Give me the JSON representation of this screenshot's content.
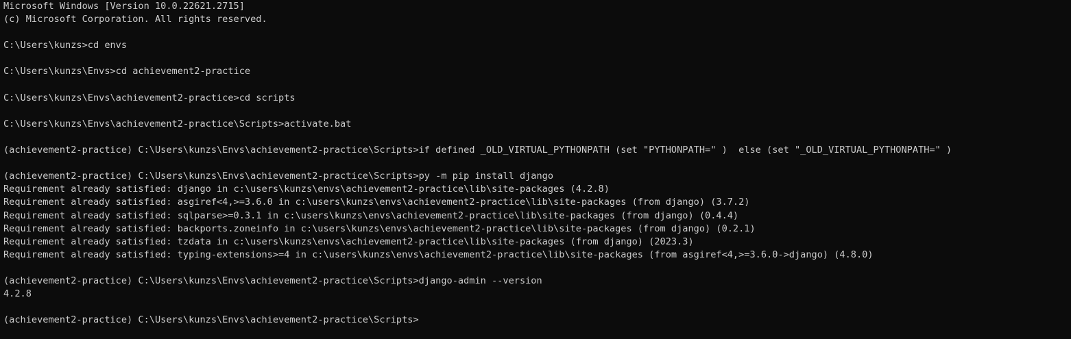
{
  "terminal": {
    "lines": [
      "Microsoft Windows [Version 10.0.22621.2715]",
      "(c) Microsoft Corporation. All rights reserved.",
      "",
      "C:\\Users\\kunzs>cd envs",
      "",
      "C:\\Users\\kunzs\\Envs>cd achievement2-practice",
      "",
      "C:\\Users\\kunzs\\Envs\\achievement2-practice>cd scripts",
      "",
      "C:\\Users\\kunzs\\Envs\\achievement2-practice\\Scripts>activate.bat",
      "",
      "(achievement2-practice) C:\\Users\\kunzs\\Envs\\achievement2-practice\\Scripts>if defined _OLD_VIRTUAL_PYTHONPATH (set \"PYTHONPATH=\" )  else (set \"_OLD_VIRTUAL_PYTHONPATH=\" )",
      "",
      "(achievement2-practice) C:\\Users\\kunzs\\Envs\\achievement2-practice\\Scripts>py -m pip install django",
      "Requirement already satisfied: django in c:\\users\\kunzs\\envs\\achievement2-practice\\lib\\site-packages (4.2.8)",
      "Requirement already satisfied: asgiref<4,>=3.6.0 in c:\\users\\kunzs\\envs\\achievement2-practice\\lib\\site-packages (from django) (3.7.2)",
      "Requirement already satisfied: sqlparse>=0.3.1 in c:\\users\\kunzs\\envs\\achievement2-practice\\lib\\site-packages (from django) (0.4.4)",
      "Requirement already satisfied: backports.zoneinfo in c:\\users\\kunzs\\envs\\achievement2-practice\\lib\\site-packages (from django) (0.2.1)",
      "Requirement already satisfied: tzdata in c:\\users\\kunzs\\envs\\achievement2-practice\\lib\\site-packages (from django) (2023.3)",
      "Requirement already satisfied: typing-extensions>=4 in c:\\users\\kunzs\\envs\\achievement2-practice\\lib\\site-packages (from asgiref<4,>=3.6.0->django) (4.8.0)",
      "",
      "(achievement2-practice) C:\\Users\\kunzs\\Envs\\achievement2-practice\\Scripts>django-admin --version",
      "4.2.8",
      "",
      "(achievement2-practice) C:\\Users\\kunzs\\Envs\\achievement2-practice\\Scripts>"
    ],
    "colors": {
      "background": "#0c0c0c",
      "foreground": "#cccccc"
    }
  }
}
